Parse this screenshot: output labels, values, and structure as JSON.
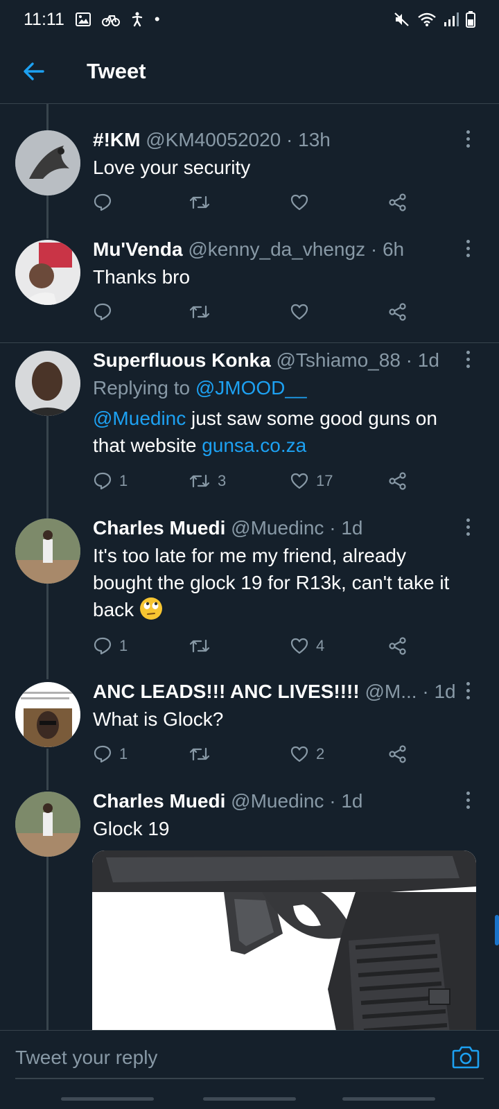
{
  "status_bar": {
    "time": "11:11",
    "dot": "•"
  },
  "header": {
    "title": "Tweet"
  },
  "tweets": [
    {
      "name": "#!KM",
      "handle": "@KM40052020 · 13h",
      "text": "Love your security",
      "counts": {
        "reply": "",
        "retweet": "",
        "like": ""
      }
    },
    {
      "name": "Mu'Venda",
      "handle": "@kenny_da_vhengz · 6h",
      "text": "Thanks bro",
      "counts": {
        "reply": "",
        "retweet": "",
        "like": ""
      }
    },
    {
      "name": "Superfluous Konka",
      "handle": "@Tshiamo_88 · 1d",
      "reply_prefix": "Replying to ",
      "reply_to": "@JMOOD__",
      "mention": "@Muedinc",
      "text_a": " just saw some good guns on",
      "text_b": "that website ",
      "link": "gunsa.co.za",
      "counts": {
        "reply": "1",
        "retweet": "3",
        "like": "17"
      }
    },
    {
      "name": "Charles Muedi",
      "handle": "@Muedinc · 1d",
      "text_l1": "It's too late for me my friend, already",
      "text_l2": "bought the glock 19 for R13k, can't take it",
      "text_l3": "back ",
      "counts": {
        "reply": "1",
        "retweet": "",
        "like": "4"
      }
    },
    {
      "name": "ANC LEADS!!! ANC LIVES!!!!",
      "handle": "@M... · 1d",
      "text": "What is Glock?",
      "counts": {
        "reply": "1",
        "retweet": "",
        "like": "2"
      }
    },
    {
      "name": "Charles Muedi",
      "handle": "@Muedinc · 1d",
      "text": "Glock 19"
    }
  ],
  "reply_bar": {
    "placeholder": "Tweet your reply"
  },
  "colors": {
    "background": "#15202b",
    "accent": "#1da1f2",
    "secondary_text": "#8899a6",
    "divider": "#38444d"
  },
  "icons": [
    "back-arrow-icon",
    "reply-icon",
    "retweet-icon",
    "like-icon",
    "share-icon",
    "more-icon",
    "camera-icon"
  ]
}
